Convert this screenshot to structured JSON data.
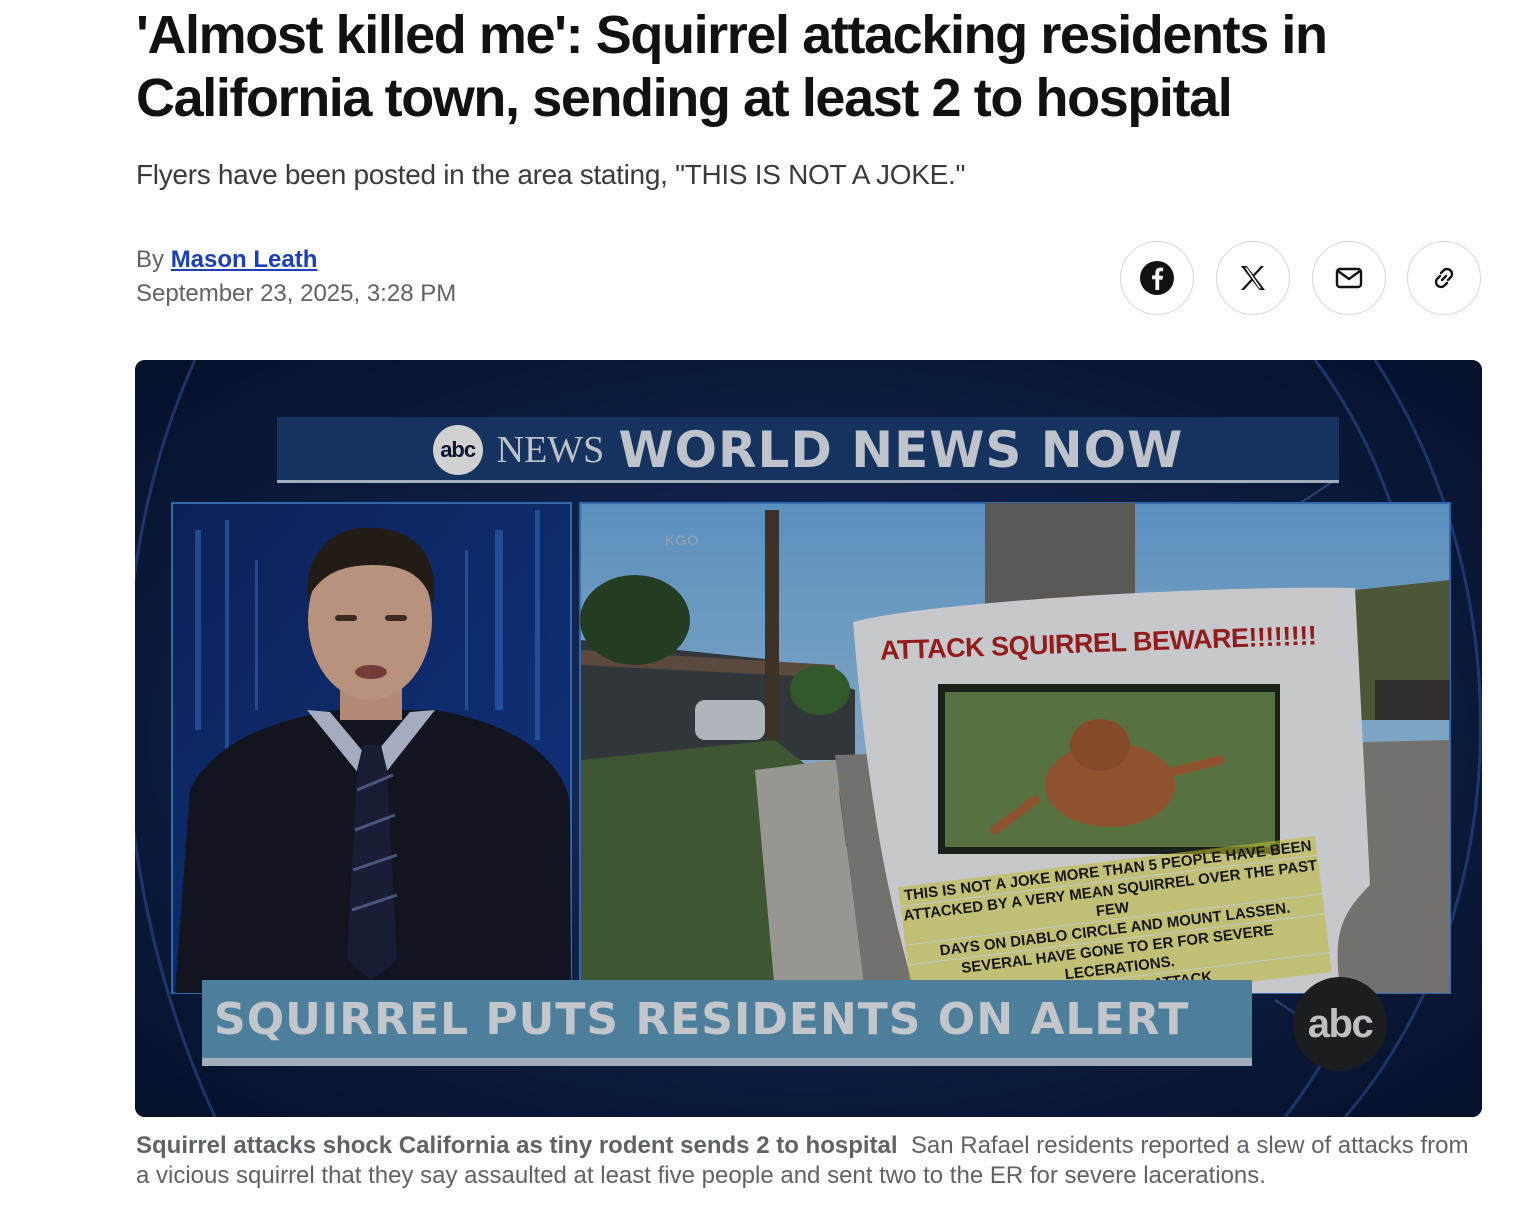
{
  "article": {
    "headline": "'Almost killed me': Squirrel attacking residents in California town, sending at least 2 to hospital",
    "dek": "Flyers have been posted in the area stating, \"THIS IS NOT A JOKE.\"",
    "byline_prefix": "By",
    "author": "Mason Leath",
    "date": "September 23, 2025, 3:28 PM"
  },
  "share": {
    "icons": [
      "facebook-icon",
      "x-icon",
      "email-icon",
      "link-icon"
    ]
  },
  "media": {
    "network": "abc",
    "network_word": "NEWS",
    "show_title": "WORLD NEWS NOW",
    "source_tag": "KGO",
    "flyer_title": "ATTACK SQUIRREL BEWARE!!!!!!!!",
    "flyer_lines": [
      "THIS IS NOT A JOKE MORE THAN 5 PEOPLE HAVE BEEN",
      "ATTACKED BY A VERY MEAN SQUIRREL OVER THE PAST FEW",
      "DAYS ON DIABLO CIRCLE AND MOUNT LASSEN.",
      "SEVERAL HAVE GONE TO ER FOR SEVERE LECERATIONS.",
      "HERE AND WILL ATTACK"
    ],
    "lower_third": "SQUIRREL PUTS RESIDENTS ON ALERT",
    "bug": "abc",
    "colors": {
      "banner": "#1c3d73",
      "lower_third": "#5e9bbf",
      "flyer_title": "#b22222"
    }
  },
  "caption": {
    "title": "Squirrel attacks shock California as tiny rodent sends 2 to hospital",
    "text": "San Rafael residents reported a slew of attacks from a vicious squirrel that they say assaulted at least five people and sent two to the ER for severe lacerations."
  }
}
